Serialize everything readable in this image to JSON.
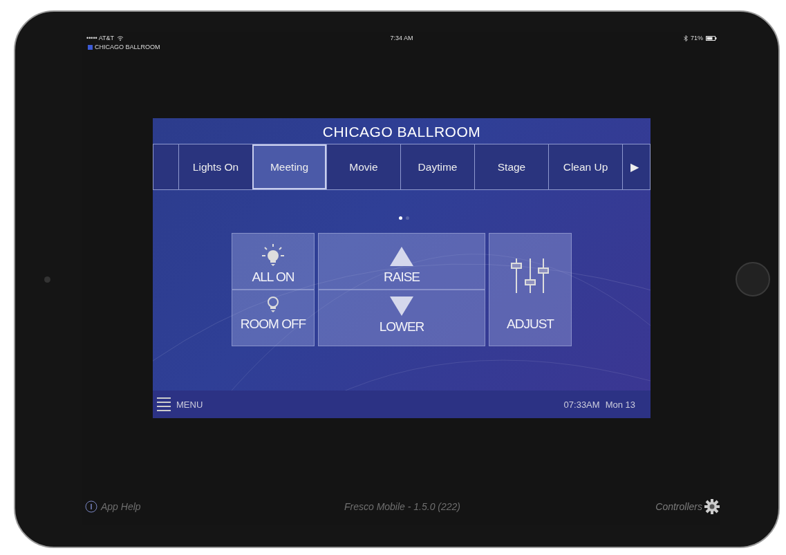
{
  "status_bar": {
    "carrier": "••••• AT&T",
    "time": "7:34 AM",
    "battery": "71%"
  },
  "app_header": {
    "room": "CHICAGO BALLROOM"
  },
  "panel": {
    "title": "CHICAGO BALLROOM",
    "tabs": [
      {
        "label": "Lights On",
        "selected": false
      },
      {
        "label": "Meeting",
        "selected": true
      },
      {
        "label": "Movie",
        "selected": false
      },
      {
        "label": "Daytime",
        "selected": false
      },
      {
        "label": "Stage",
        "selected": false
      },
      {
        "label": "Clean Up",
        "selected": false
      }
    ],
    "next_arrow": "▶",
    "page_dots": [
      {
        "selected": true
      },
      {
        "selected": false
      }
    ],
    "controls": [
      {
        "kind": "all_on",
        "label": "ALL ON"
      },
      {
        "kind": "raise",
        "label": "RAISE"
      },
      {
        "kind": "room_off",
        "label": "ROOM OFF"
      },
      {
        "kind": "lower",
        "label": "LOWER"
      },
      {
        "kind": "adjust",
        "label": "ADJUST"
      }
    ],
    "footer": {
      "menu": "MENU",
      "clock": "07:33AM",
      "date": "Mon 13"
    }
  },
  "bottom_bar": {
    "help": "App Help",
    "version": "Fresco Mobile - 1.5.0 (222)",
    "controllers": "Controllers"
  }
}
